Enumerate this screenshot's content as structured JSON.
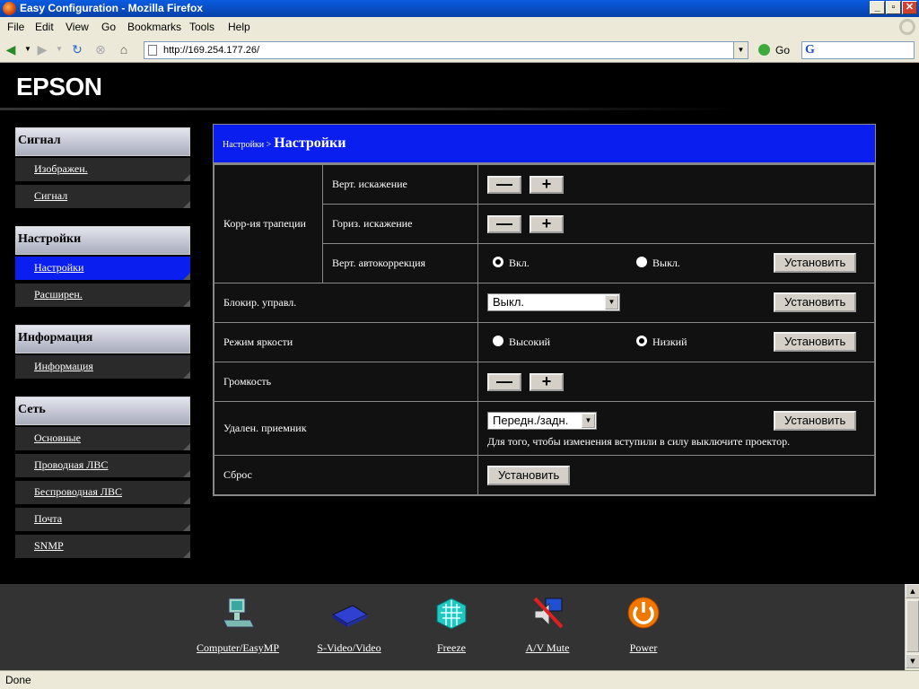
{
  "window": {
    "title": "Easy Configuration - Mozilla Firefox"
  },
  "menubar": {
    "items": [
      "File",
      "Edit",
      "View",
      "Go",
      "Bookmarks",
      "Tools",
      "Help"
    ]
  },
  "navbar": {
    "url": "http://169.254.177.26/",
    "go_label": "Go",
    "search_logo": "G"
  },
  "brand": {
    "logo": "EPSON"
  },
  "sidebar": {
    "sections": [
      {
        "title": "Сигнал",
        "items": [
          "Изображен.",
          "Сигнал"
        ]
      },
      {
        "title": "Настройки",
        "items": [
          "Настройки",
          "Расширен."
        ]
      },
      {
        "title": "Информация",
        "items": [
          "Информация"
        ]
      },
      {
        "title": "Сеть",
        "items": [
          "Основные",
          "Проводная ЛВС",
          "Беспроводная ЛВС",
          "Почта",
          "SNMP"
        ]
      }
    ],
    "active": "Настройки"
  },
  "panel": {
    "breadcrumb": "Настройки >",
    "title": "Настройки",
    "keystone": {
      "label": "Корр-ия трапеции",
      "vert_label": "Верт. искажение",
      "horiz_label": "Гориз. искажение",
      "auto_label": "Верт. автокоррекция",
      "auto_on": "Вкл.",
      "auto_off": "Выкл.",
      "auto_selected": "on"
    },
    "lock": {
      "label": "Блокир. управл.",
      "value": "Выкл."
    },
    "brightness": {
      "label": "Режим яркости",
      "high": "Высокий",
      "low": "Низкий",
      "selected": "low"
    },
    "volume": {
      "label": "Громкость"
    },
    "remote": {
      "label": "Удален. приемник",
      "value": "Передн./задн.",
      "hint": "Для того, чтобы изменения вступили в силу выключите проектор."
    },
    "reset": {
      "label": "Сброс"
    },
    "minus_label": "—",
    "plus_label": "+",
    "apply_label": "Установить"
  },
  "footer": {
    "items": [
      {
        "label": "Computer/EasyMP",
        "icon": "computer-icon"
      },
      {
        "label": "S-Video/Video",
        "icon": "video-device-icon"
      },
      {
        "label": "Freeze",
        "icon": "freeze-icon"
      },
      {
        "label": "A/V Mute",
        "icon": "av-mute-icon"
      },
      {
        "label": "Power",
        "icon": "power-icon"
      }
    ]
  },
  "statusbar": {
    "text": "Done"
  },
  "colors": {
    "accent": "#0a1ef0",
    "panel_bg": "#111111",
    "sidebar_item": "#2a2a2a"
  }
}
